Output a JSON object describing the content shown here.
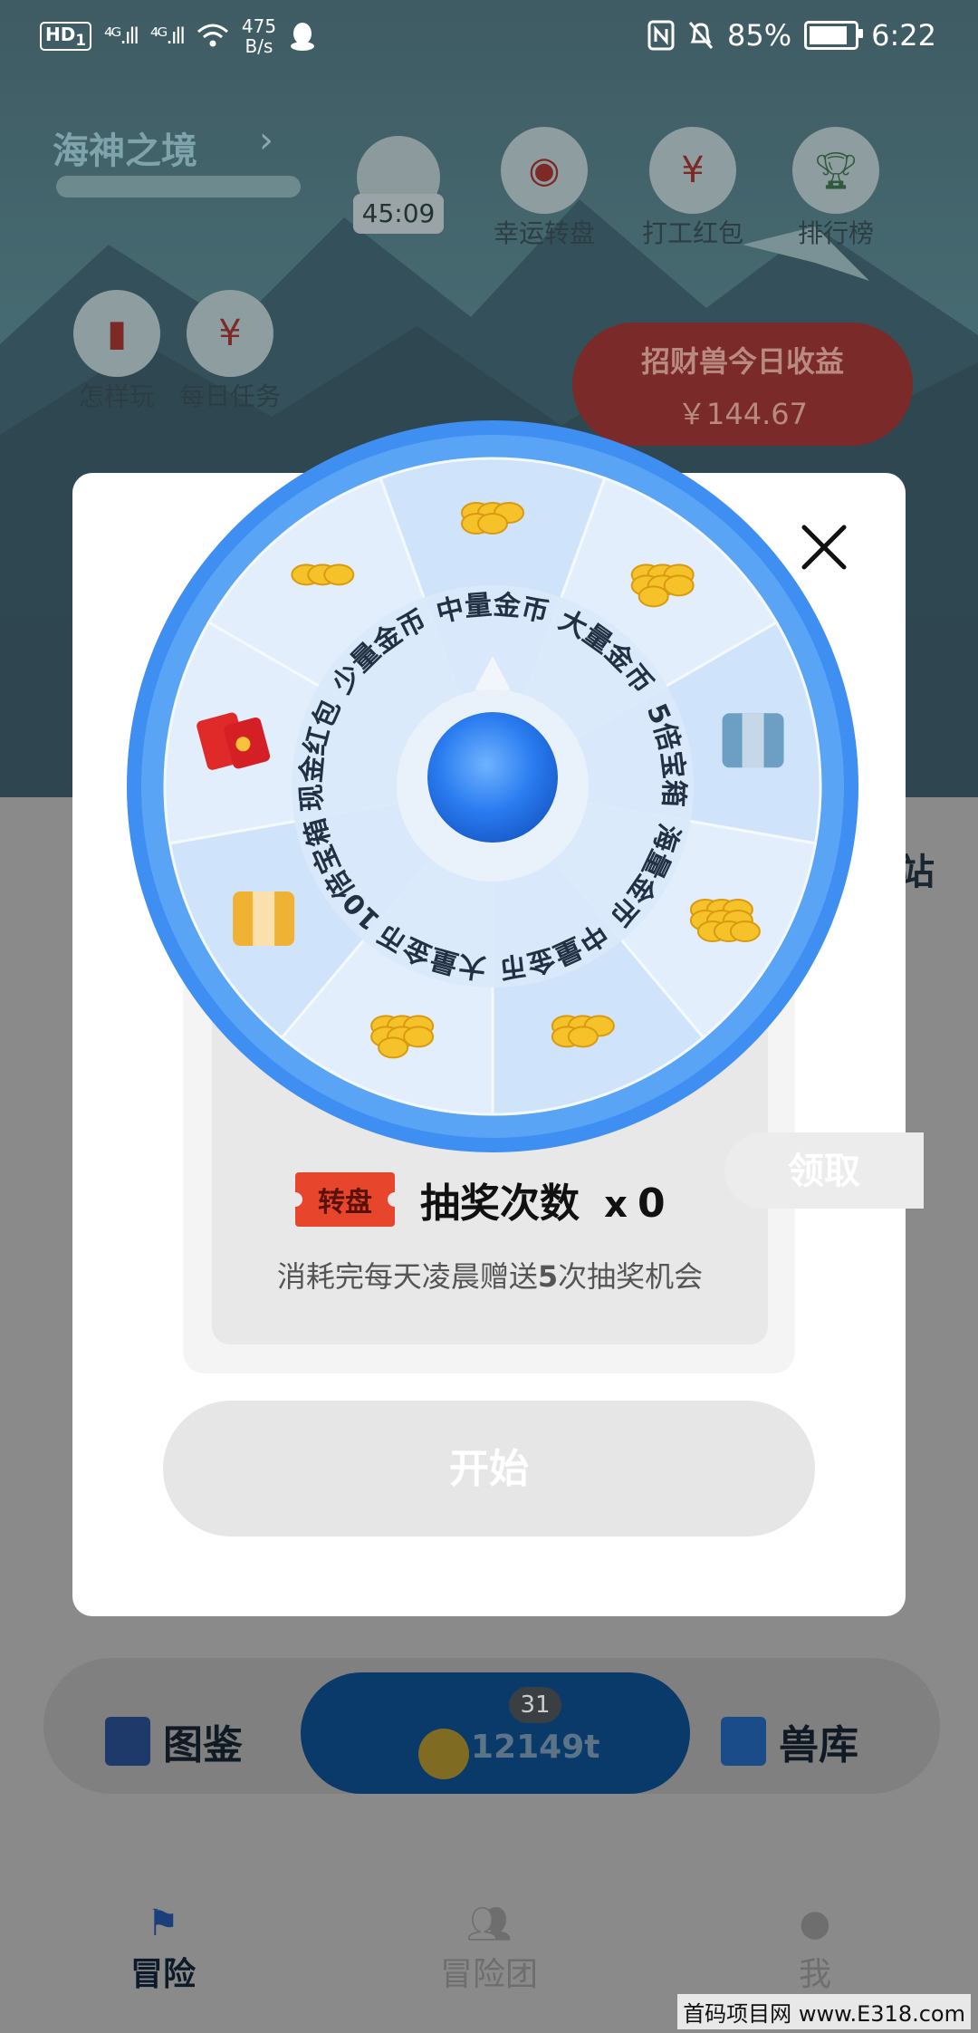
{
  "status_bar": {
    "hd": "HD",
    "hd_sub": "1",
    "signal1": "⁴ᴳ.ıll",
    "signal2": "⁴ᴳ.ıll",
    "net_speed_value": "475",
    "net_speed_unit": "B/s",
    "battery_percent": "85%",
    "battery_level": 0.85,
    "time": "6:22"
  },
  "background": {
    "map_title": "海神之境",
    "map_arrow": "›",
    "timer": "45:09",
    "top_icons": [
      {
        "label": "幸运转盘",
        "icon": "roulette-icon"
      },
      {
        "label": "打工红包",
        "icon": "red-envelope-icon"
      },
      {
        "label": "排行榜",
        "icon": "trophy-icon"
      }
    ],
    "side_icons": [
      {
        "label": "怎样玩",
        "icon": "book-icon"
      },
      {
        "label": "每日任务",
        "icon": "red-envelope-icon"
      }
    ],
    "earnings": {
      "title": "招财兽今日收益",
      "value": "￥144.67"
    },
    "side_label": "站",
    "bottom": {
      "left_label": "图鉴",
      "right_label": "兽库",
      "badge": "31",
      "coin_value": "12149t"
    },
    "nav": [
      {
        "label": "冒险",
        "icon": "flag-icon"
      },
      {
        "label": "冒险团",
        "icon": "group-icon"
      },
      {
        "label": "我",
        "icon": "user-icon"
      }
    ]
  },
  "modal": {
    "wheel_segments": [
      "少量金币",
      "中量金币",
      "大量金币",
      "5倍宝箱",
      "海量金币",
      "中量金币",
      "大量金币",
      "10倍宝箱",
      "现金红包"
    ],
    "ticket_text": "转盘",
    "draw_label": "抽奖次数",
    "draw_x": "x",
    "draw_count": "0",
    "note_before": "消耗完每天凌晨赠送",
    "note_num": "5",
    "note_after": "次抽奖机会",
    "claim_label": "领取",
    "start_label": "开始",
    "close_icon": "close-icon"
  },
  "watermark": "首码项目网  www.E318.com"
}
